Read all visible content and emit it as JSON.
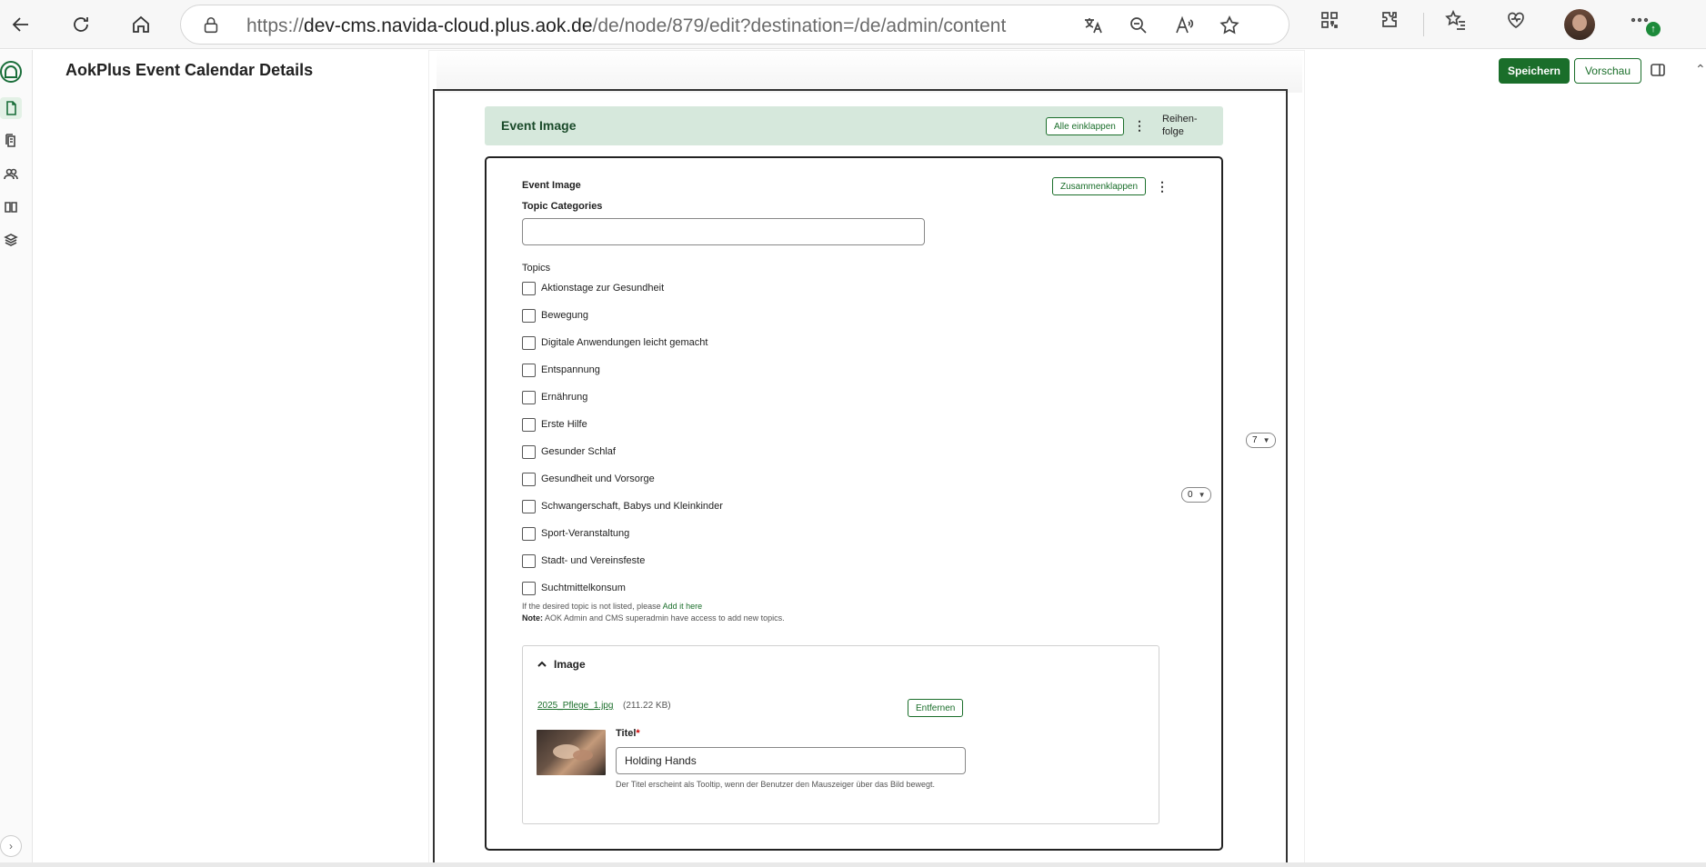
{
  "browser": {
    "url_prefix": "https://",
    "url_host": "dev-cms.navida-cloud.plus.aok.de",
    "url_path": "/de/node/879/edit?destination=/de/admin/content"
  },
  "header": {
    "title": "AokPlus Event Calendar Details",
    "save_label": "Speichern",
    "preview_label": "Vorschau"
  },
  "group": {
    "title": "Event Image",
    "collapse_all_label": "Alle einklappen",
    "order_label": "Reihen-folge"
  },
  "paragraph": {
    "title": "Event Image",
    "collapse_label": "Zusammenklappen",
    "topic_categories_label": "Topic Categories",
    "topic_categories_value": "",
    "topics_label": "Topics",
    "topics": [
      "Aktionstage zur Gesundheit",
      "Bewegung",
      "Digitale Anwendungen leicht gemacht",
      "Entspannung",
      "Ernährung",
      "Erste Hilfe",
      "Gesunder Schlaf",
      "Gesundheit und Vorsorge",
      "Schwangerschaft, Babys und Kleinkinder",
      "Sport-Veranstaltung",
      "Stadt- und Vereinsfeste",
      "Suchtmittelkonsum"
    ],
    "hint_text": "If the desired topic is not listed, please ",
    "hint_link": "Add it here",
    "note_label": "Note:",
    "note_text": " AOK Admin and CMS superadmin have access to add new topics."
  },
  "image": {
    "section_label": "Image",
    "file_name": "2025_Pflege_1.jpg",
    "file_size": "(211.22 KB)",
    "remove_label": "Entfernen",
    "title_label": "Titel",
    "title_required": "*",
    "title_value": "Holding Hands",
    "title_description": "Der Titel erscheint als Tooltip, wenn der Benutzer den Mauszeiger über das Bild bewegt."
  },
  "weights": {
    "inner": "0",
    "outer": "7"
  },
  "colors": {
    "brand_green": "#1a6e2a",
    "group_header_bg": "#d6e8dc"
  }
}
